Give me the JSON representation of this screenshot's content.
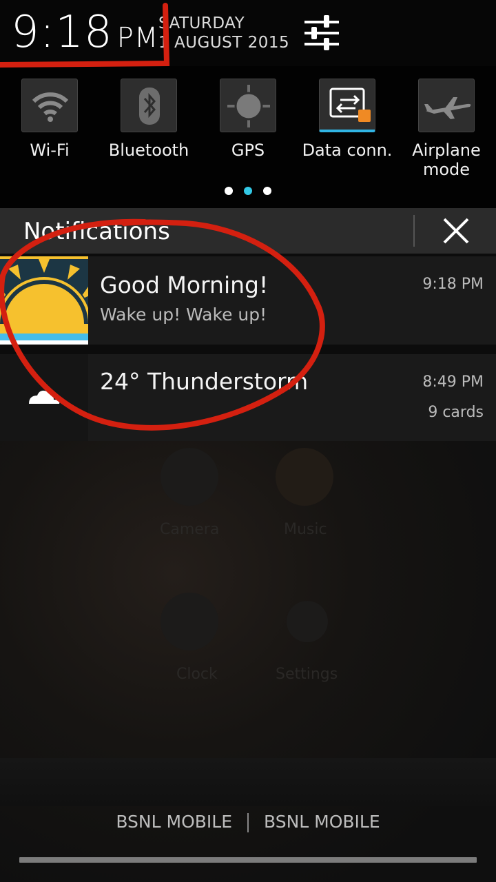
{
  "status": {
    "time": "9:18",
    "ampm": "PM",
    "day": "SATURDAY",
    "date": "1 AUGUST 2015"
  },
  "toggles": [
    {
      "label": "Wi-Fi",
      "icon": "wifi-icon",
      "active": false
    },
    {
      "label": "Bluetooth",
      "icon": "bluetooth-icon",
      "active": false
    },
    {
      "label": "GPS",
      "icon": "gps-icon",
      "active": false
    },
    {
      "label": "Data conn.",
      "icon": "data-connection-icon",
      "active": true
    },
    {
      "label": "Airplane mode",
      "icon": "airplane-icon",
      "active": false
    }
  ],
  "pager": {
    "pages": 3,
    "current": 2
  },
  "notifications": {
    "title": "Notifications",
    "items": [
      {
        "title": "Good Morning!",
        "subtitle": "Wake up! Wake up!",
        "time": "9:18 PM",
        "icon": "sunrise-icon"
      },
      {
        "title": "24° Thunderstorm",
        "time": "8:49 PM",
        "info": "9 cards",
        "icon": "cloud-icon"
      }
    ]
  },
  "background_apps": [
    "Camera",
    "Music",
    "Clock",
    "Settings"
  ],
  "carrier": {
    "sim1": "BSNL MOBILE",
    "sim2": "BSNL MOBILE"
  },
  "colors": {
    "accent": "#33c9e6",
    "annotation": "#d42010"
  }
}
